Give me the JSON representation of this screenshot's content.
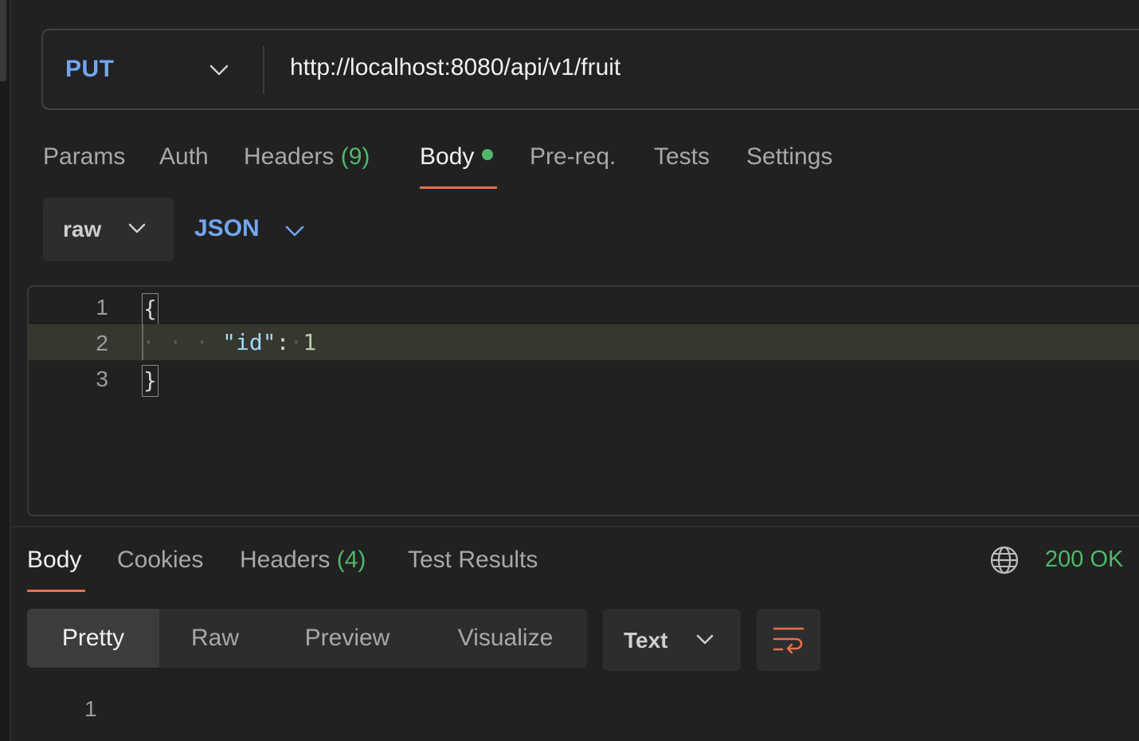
{
  "request": {
    "method": "PUT",
    "url": "http://localhost:8080/api/v1/fruit",
    "tabs": [
      {
        "label": "Params",
        "count": ""
      },
      {
        "label": "Auth",
        "count": ""
      },
      {
        "label": "Headers",
        "count": "(9)"
      },
      {
        "label": "Body",
        "count": "",
        "active": true,
        "modified_dot": true
      },
      {
        "label": "Pre-req.",
        "count": ""
      },
      {
        "label": "Tests",
        "count": ""
      },
      {
        "label": "Settings",
        "count": ""
      }
    ],
    "body_mode": "raw",
    "body_language": "JSON",
    "editor": {
      "line_numbers": [
        "1",
        "2",
        "3"
      ],
      "open_brace": "{",
      "indent_dots": "· · · ",
      "key": "\"id\"",
      "colon": ":",
      "value_dot": "·",
      "value": "1",
      "close_brace": "}",
      "highlighted_line": 2
    }
  },
  "response": {
    "tabs": [
      {
        "label": "Body",
        "count": "",
        "active": true
      },
      {
        "label": "Cookies",
        "count": ""
      },
      {
        "label": "Headers",
        "count": "(4)"
      },
      {
        "label": "Test Results",
        "count": ""
      }
    ],
    "status": "200 OK",
    "status_color": "#4fb86a",
    "view_modes": [
      "Pretty",
      "Raw",
      "Preview",
      "Visualize"
    ],
    "active_view_mode": "Pretty",
    "format": "Text",
    "line_numbers": [
      "1"
    ]
  },
  "colors": {
    "accent_blue": "#73a6f0",
    "tab_underline": "#e8704b",
    "success_green": "#4fb86a",
    "background": "#212121"
  },
  "icons": {
    "method_dropdown": "chevron-down-icon",
    "globe": "globe-icon",
    "wrap": "wrap-lines-icon"
  }
}
